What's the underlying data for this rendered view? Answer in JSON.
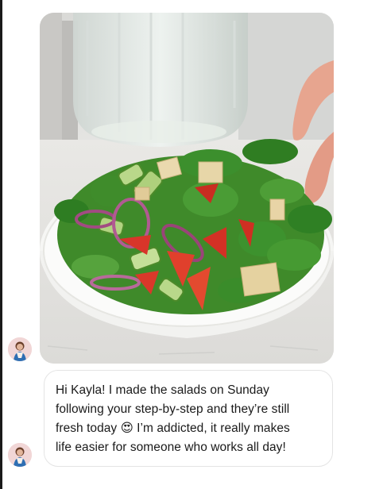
{
  "messages": [
    {
      "type": "image",
      "alt": ""
    },
    {
      "type": "text",
      "lines": [
        "Hi Kayla! I made the salads on Sunday",
        "following your step-by-step and they’re still",
        "fresh today 😍 I’m addicted, it really makes",
        "life easier for someone who works all day!"
      ]
    }
  ],
  "colors": {
    "bubble_border": "#e4e4e4",
    "text": "#1a1a1a",
    "avatar_bg": "#f1d6d6"
  },
  "icons": {
    "avatar": "profile-avatar-icon"
  }
}
